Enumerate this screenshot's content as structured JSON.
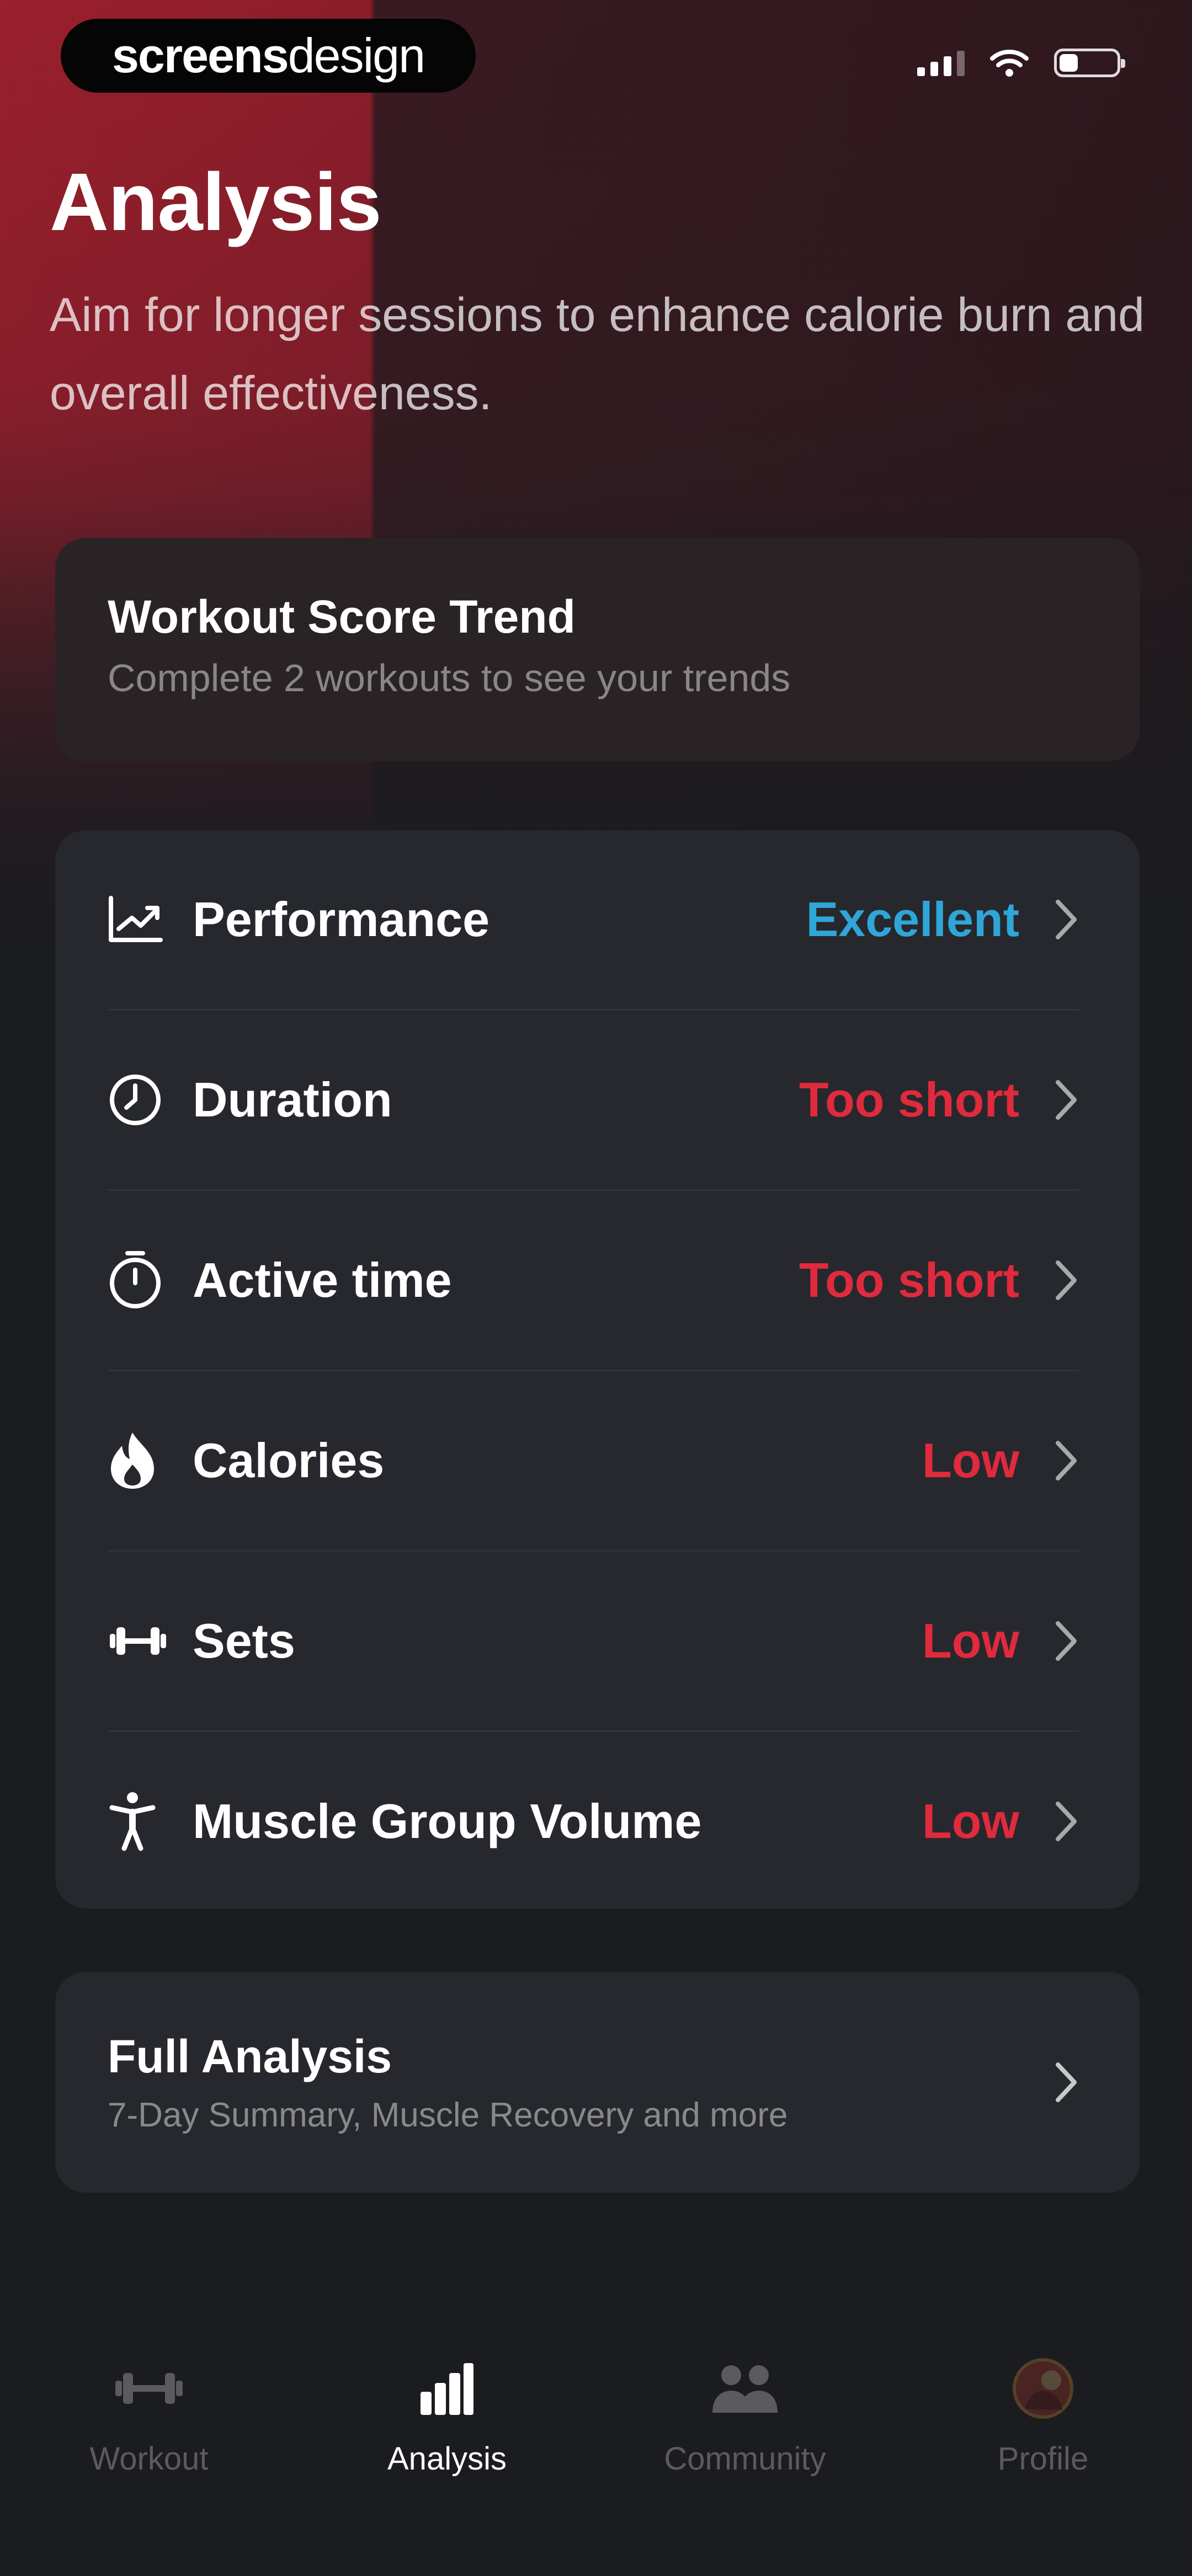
{
  "status_bar": {
    "brand_bold": "screens",
    "brand_light": "design",
    "battery_level": 0.3
  },
  "header": {
    "title": "Analysis",
    "subtitle": "Aim for longer sessions to enhance calorie burn and overall effectiveness."
  },
  "trend_card": {
    "title": "Workout Score Trend",
    "subtitle": "Complete 2 workouts to see your trends"
  },
  "metrics": [
    {
      "label": "Performance",
      "value": "Excellent",
      "icon": "chart-trend-icon",
      "value_color": "#2fa6d8"
    },
    {
      "label": "Duration",
      "value": "Too short",
      "icon": "clock-icon",
      "value_color": "#e02a3d"
    },
    {
      "label": "Active time",
      "value": "Too short",
      "icon": "stopwatch-icon",
      "value_color": "#e02a3d"
    },
    {
      "label": "Calories",
      "value": "Low",
      "icon": "flame-icon",
      "value_color": "#e02a3d"
    },
    {
      "label": "Sets",
      "value": "Low",
      "icon": "dumbbell-icon",
      "value_color": "#e02a3d"
    },
    {
      "label": "Muscle Group Volume",
      "value": "Low",
      "icon": "body-icon",
      "value_color": "#e02a3d"
    }
  ],
  "full_analysis": {
    "title": "Full Analysis",
    "subtitle": "7-Day Summary, Muscle Recovery and more"
  },
  "tabs": [
    {
      "label": "Workout",
      "icon": "dumbbell-icon",
      "active": false
    },
    {
      "label": "Analysis",
      "icon": "bar-chart-icon",
      "active": true
    },
    {
      "label": "Community",
      "icon": "people-icon",
      "active": false
    },
    {
      "label": "Profile",
      "icon": "avatar-icon",
      "active": false
    }
  ],
  "colors": {
    "accent_blue": "#2fa6d8",
    "accent_red": "#e02a3d",
    "card_bg": "#27282d",
    "page_bg": "#1b1c20"
  }
}
